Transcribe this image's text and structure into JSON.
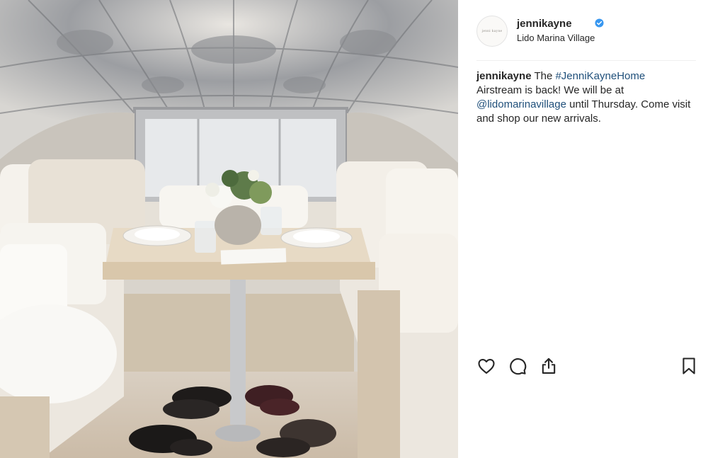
{
  "post": {
    "username": "jennikayne",
    "location": "Lido Marina Village",
    "avatar_text": "jenni kayne",
    "verified_icon": "verified-badge-icon",
    "caption": {
      "username": "jennikayne",
      "part1": " The ",
      "hashtag": "#JenniKayneHome",
      "part2": " Airstream is back! We will be at ",
      "mention": "@lidomarinavillage",
      "part3": " until Thursday. Come visit and shop our new arrivals."
    },
    "actions": {
      "like_icon": "heart-icon",
      "comment_icon": "comment-icon",
      "share_icon": "share-icon",
      "save_icon": "bookmark-icon"
    },
    "colors": {
      "text": "#262626",
      "link": "#1f4f7a",
      "verified": "#3897f0",
      "divider": "#efefef"
    }
  }
}
